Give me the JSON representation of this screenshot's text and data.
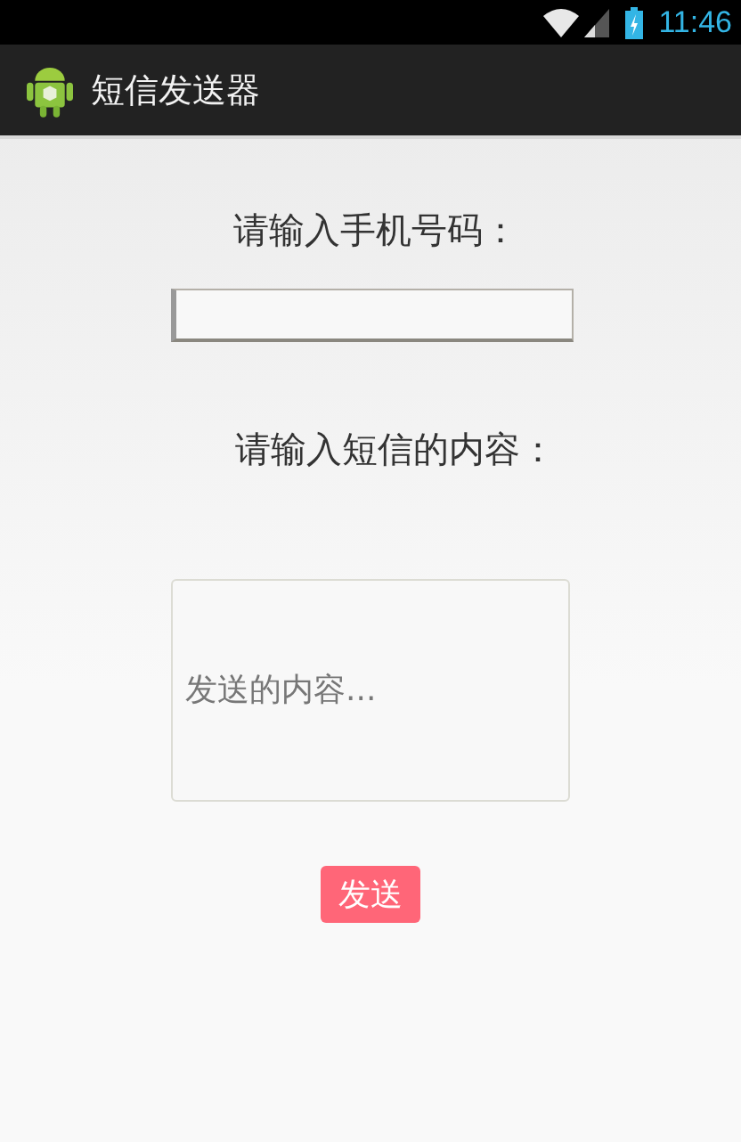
{
  "status_bar": {
    "time": "11:46"
  },
  "action_bar": {
    "title": "短信发送器"
  },
  "form": {
    "phone_label": "请输入手机号码：",
    "content_label": "请输入短信的内容：",
    "content_field": {
      "placeholder": "发送的内容..."
    },
    "send_button": "发送"
  }
}
